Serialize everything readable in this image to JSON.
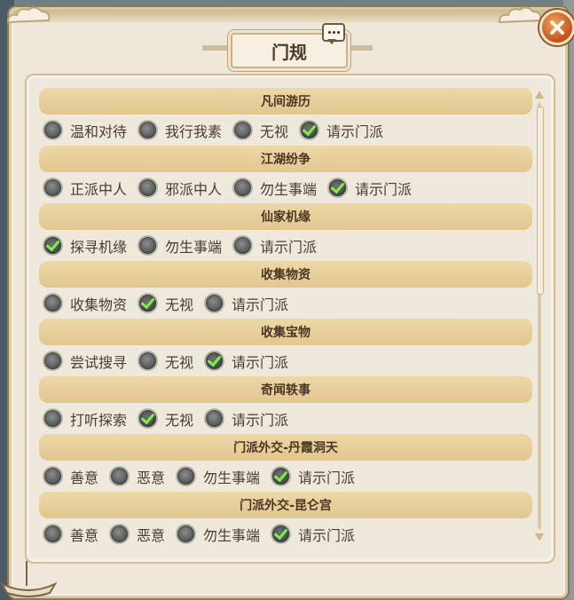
{
  "dialog": {
    "title": "门规"
  },
  "categories": [
    {
      "title": "凡间游历",
      "options": [
        {
          "label": "温和对待",
          "selected": false
        },
        {
          "label": "我行我素",
          "selected": false
        },
        {
          "label": "无视",
          "selected": false
        },
        {
          "label": "请示门派",
          "selected": true
        }
      ]
    },
    {
      "title": "江湖纷争",
      "options": [
        {
          "label": "正派中人",
          "selected": false
        },
        {
          "label": "邪派中人",
          "selected": false
        },
        {
          "label": "勿生事端",
          "selected": false
        },
        {
          "label": "请示门派",
          "selected": true
        }
      ]
    },
    {
      "title": "仙家机缘",
      "options": [
        {
          "label": "探寻机缘",
          "selected": true
        },
        {
          "label": "勿生事端",
          "selected": false
        },
        {
          "label": "请示门派",
          "selected": false
        }
      ]
    },
    {
      "title": "收集物资",
      "options": [
        {
          "label": "收集物资",
          "selected": false
        },
        {
          "label": "无视",
          "selected": true
        },
        {
          "label": "请示门派",
          "selected": false
        }
      ]
    },
    {
      "title": "收集宝物",
      "options": [
        {
          "label": "尝试搜寻",
          "selected": false
        },
        {
          "label": "无视",
          "selected": false
        },
        {
          "label": "请示门派",
          "selected": true
        }
      ]
    },
    {
      "title": "奇闻轶事",
      "options": [
        {
          "label": "打听探索",
          "selected": false
        },
        {
          "label": "无视",
          "selected": true
        },
        {
          "label": "请示门派",
          "selected": false
        }
      ]
    },
    {
      "title": "门派外交-丹霞洞天",
      "options": [
        {
          "label": "善意",
          "selected": false
        },
        {
          "label": "恶意",
          "selected": false
        },
        {
          "label": "勿生事端",
          "selected": false
        },
        {
          "label": "请示门派",
          "selected": true
        }
      ]
    },
    {
      "title": "门派外交-昆仑宫",
      "options": [
        {
          "label": "善意",
          "selected": false
        },
        {
          "label": "恶意",
          "selected": false
        },
        {
          "label": "勿生事端",
          "selected": false
        },
        {
          "label": "请示门派",
          "selected": true
        }
      ]
    }
  ],
  "colors": {
    "panel_bg": "#efe8da",
    "header_bg": "#e2c68e",
    "check": "#7ef04a",
    "close_button": "#c4501d"
  },
  "icons": {
    "close": "close-icon",
    "chat": "chat-bubble-icon",
    "radio_checked": "checkmark-icon"
  }
}
